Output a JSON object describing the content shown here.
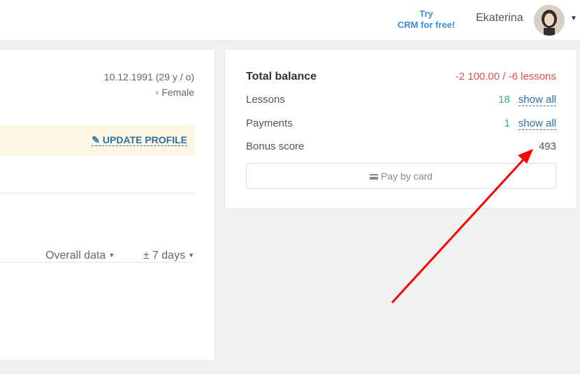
{
  "header": {
    "try_crm_line1": "Try",
    "try_crm_line2": "CRM for free!",
    "user_name": "Ekaterina"
  },
  "profile": {
    "birth_date": "10.12.1991 (29 y / o)",
    "gender": "Female",
    "update_profile_label": "UPDATE PROFILE",
    "filter_overall": "Overall data",
    "filter_days": "± 7 days"
  },
  "balance": {
    "total_label": "Total balance",
    "total_value": "-2 100.00 / -6 lessons",
    "lessons_label": "Lessons",
    "lessons_count": "18",
    "payments_label": "Payments",
    "payments_count": "1",
    "show_all": "show all",
    "bonus_label": "Bonus score",
    "bonus_value": "493",
    "pay_by_card": "Pay by card"
  },
  "colors": {
    "accent_blue": "#2d6fa8",
    "negative_red": "#e05050",
    "count_green": "#2db88a",
    "annotation_red": "#ff0000",
    "notice_bg": "#fcf8e3"
  },
  "icons": [
    "gender-female-icon",
    "pencil-icon",
    "caret-down-icon",
    "credit-card-icon",
    "avatar"
  ]
}
